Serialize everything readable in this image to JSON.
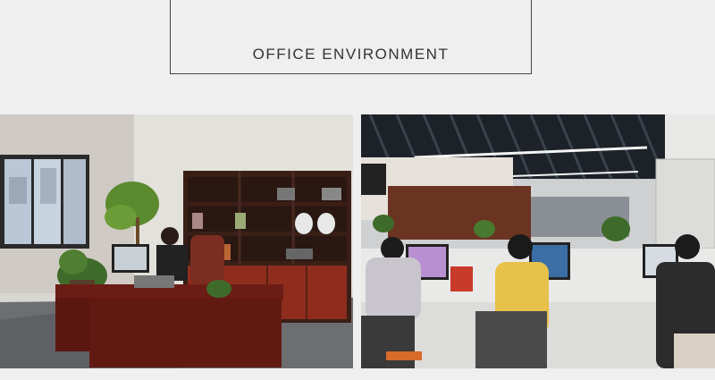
{
  "header": {
    "title": "OFFICE ENVIRONMENT"
  },
  "photos": [
    {
      "name": "office-manager-room"
    },
    {
      "name": "open-plan-office"
    }
  ]
}
